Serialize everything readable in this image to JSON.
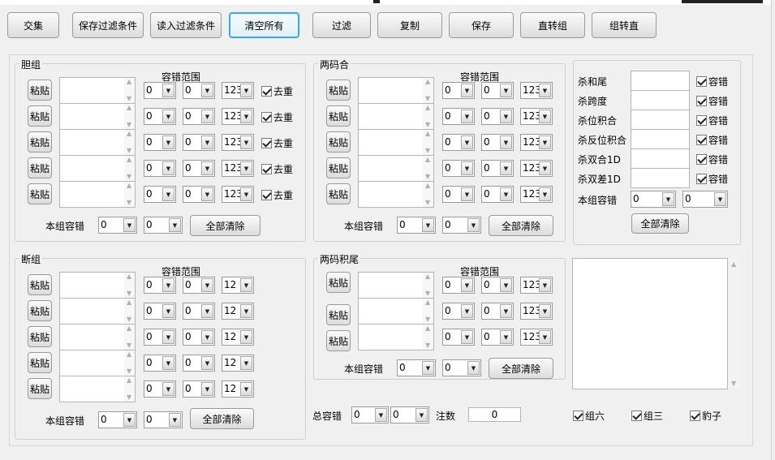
{
  "toolbar": {
    "b0": "交集",
    "b1": "保存过滤条件",
    "b2": "读入过滤条件",
    "b3": "清空所有",
    "b4": "过滤",
    "b5": "复制",
    "b6": "保存",
    "b7": "直转组",
    "b8": "组转直"
  },
  "dan": {
    "title": "胆组",
    "range": "容错范围",
    "paste": "粘贴",
    "v0": "0",
    "v1": "0",
    "v2": "123",
    "dedup": "去重",
    "tol": "本组容错",
    "t0": "0",
    "t1": "0",
    "clear": "全部清除"
  },
  "lma": {
    "title": "两码合",
    "range": "容错范围",
    "paste": "粘贴",
    "v0": "0",
    "v1": "0",
    "v2": "123",
    "tol": "本组容错",
    "t0": "0",
    "t1": "0",
    "clear": "全部清除"
  },
  "right": {
    "l0": "杀和尾",
    "l1": "杀跨度",
    "l2": "杀位积合",
    "l3": "杀反位积合",
    "l4": "杀双合1D",
    "l5": "杀双差1D",
    "cb": "容错",
    "tol": "本组容错",
    "t0": "0",
    "t1": "0",
    "clear": "全部清除"
  },
  "duan": {
    "title": "断组",
    "range": "容错范围",
    "paste": "粘贴",
    "v0": "0",
    "v1": "0",
    "v2": "12",
    "tol": "本组容错",
    "t0": "0",
    "t1": "0",
    "clear": "全部清除"
  },
  "lmj": {
    "title": "两码积尾",
    "range": "容错范围",
    "paste": "粘贴",
    "v0": "0",
    "v1": "0",
    "v2": "123",
    "tol": "本组容错",
    "t0": "0",
    "t1": "0",
    "clear": "全部清除"
  },
  "bottom": {
    "total": "总容错",
    "t0": "0",
    "t1": "0",
    "zhushu": "注数",
    "count": "0",
    "c1": "组六",
    "c2": "组三",
    "c3": "豹子"
  }
}
